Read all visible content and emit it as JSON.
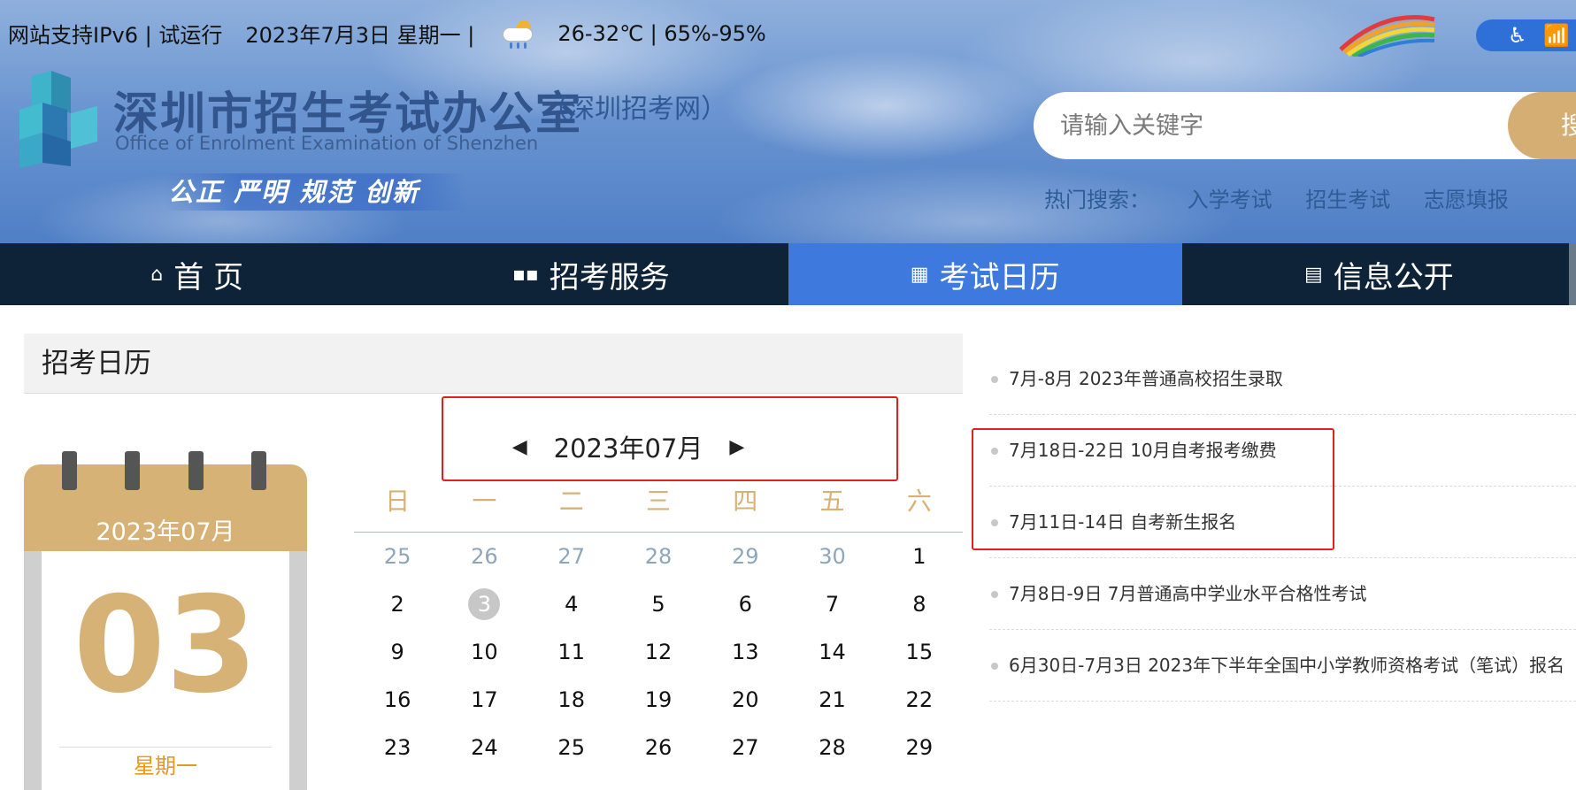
{
  "topbar": {
    "ipv6": "网站支持IPv6 | 试运行",
    "date": "2023年7月3日 星期一 |",
    "weather": "26-32℃ | 65%-95%"
  },
  "brand": {
    "title": "深圳市招生考试办公室",
    "subtitle": "（深圳招考网）",
    "english": "Office of Enrolment Examination of Shenzhen",
    "slogan": "公正  严明  规范  创新"
  },
  "search": {
    "placeholder": "请输入关键字",
    "button_label": "搜",
    "hot_label": "热门搜索：",
    "hot_items": [
      "入学考试",
      "招生考试",
      "志愿填报"
    ]
  },
  "nav": {
    "items": [
      {
        "label": "首 页",
        "icon": "home-icon"
      },
      {
        "label": "招考服务",
        "icon": "grid-icon"
      },
      {
        "label": "考试日历",
        "icon": "calendar-icon"
      },
      {
        "label": "信息公开",
        "icon": "document-icon"
      }
    ],
    "active_index": 2
  },
  "panel": {
    "title": "招考日历"
  },
  "date_card": {
    "year_month": "2023年07月",
    "day": "03",
    "weekday": "星期一"
  },
  "calendar": {
    "month_label": "2023年07月",
    "prev_arrow": "◀",
    "next_arrow": "▶",
    "weekday_headers": [
      "日",
      "一",
      "二",
      "三",
      "四",
      "五",
      "六"
    ],
    "weeks": [
      [
        "25",
        "26",
        "27",
        "28",
        "29",
        "30",
        "1"
      ],
      [
        "2",
        "3",
        "4",
        "5",
        "6",
        "7",
        "8"
      ],
      [
        "9",
        "10",
        "11",
        "12",
        "13",
        "14",
        "15"
      ],
      [
        "16",
        "17",
        "18",
        "19",
        "20",
        "21",
        "22"
      ],
      [
        "23",
        "24",
        "25",
        "26",
        "27",
        "28",
        "29"
      ]
    ],
    "today": "3"
  },
  "events": [
    "7月-8月 2023年普通高校招生录取",
    "7月18日-22日 10月自考报考缴费",
    "7月11日-14日 自考新生报名",
    "7月8日-9日 7月普通高中学业水平合格性考试",
    "6月30日-7月3日 2023年下半年全国中小学教师资格考试（笔试）报名"
  ],
  "colors": {
    "nav_bg": "#0f2338",
    "nav_active": "#3e7ade",
    "gold": "#d7b276",
    "highlight_box": "#e21e1e"
  }
}
